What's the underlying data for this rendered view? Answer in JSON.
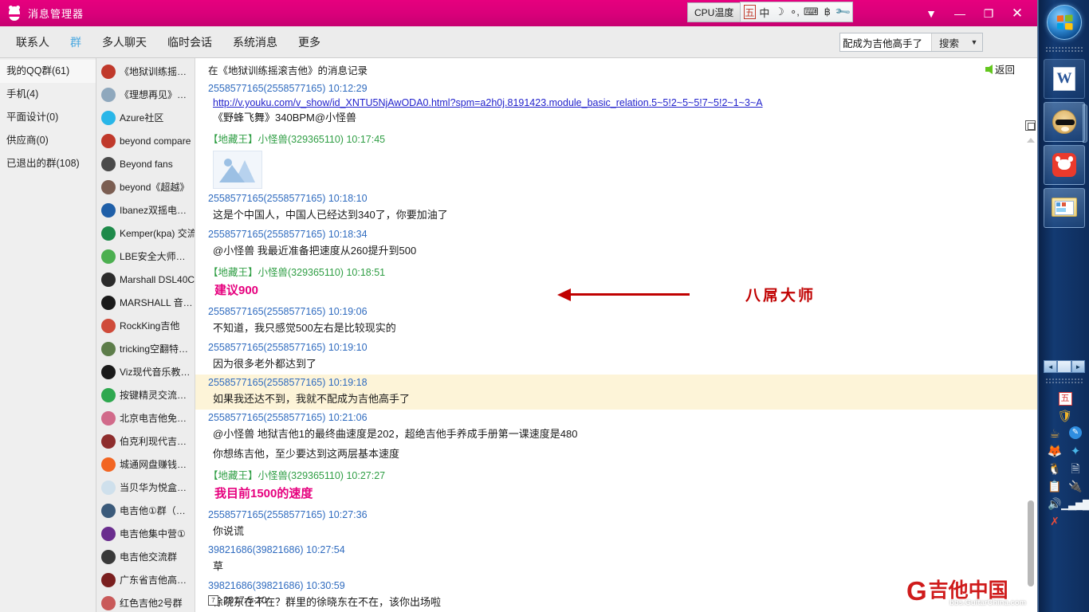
{
  "window": {
    "title": "消息管理器",
    "icon": "qq-penguin-icon",
    "cpu_gadget_label": "CPU温度",
    "controls": {
      "dropdown": "▼",
      "minimize": "—",
      "restore": "❐",
      "close": "✕"
    }
  },
  "ime_bar": {
    "items": [
      {
        "name": "ime-logo",
        "glyph": "五"
      },
      {
        "name": "ime-chinese-mode",
        "glyph": "中"
      },
      {
        "name": "ime-halfwidth",
        "glyph": "☽"
      },
      {
        "name": "ime-punctuation",
        "glyph": "∘,"
      },
      {
        "name": "ime-soft-keyboard",
        "glyph": "⌨"
      },
      {
        "name": "ime-handwriting",
        "glyph": "฿"
      },
      {
        "name": "ime-settings",
        "glyph": "🔧"
      }
    ]
  },
  "tabs": [
    {
      "label": "联系人",
      "active": false
    },
    {
      "label": "群",
      "active": true
    },
    {
      "label": "多人聊天",
      "active": false
    },
    {
      "label": "临时会话",
      "active": false
    },
    {
      "label": "系统消息",
      "active": false
    },
    {
      "label": "更多",
      "active": false
    }
  ],
  "search": {
    "value": "配成为吉他高手了",
    "placeholder": "",
    "button_label": "搜索",
    "caret": "▼"
  },
  "categories": [
    {
      "label": "我的QQ群(61)",
      "active": true
    },
    {
      "label": "手机(4)",
      "active": false
    },
    {
      "label": "平面设计(0)",
      "active": false
    },
    {
      "label": "供应商(0)",
      "active": false
    },
    {
      "label": "已退出的群(108)",
      "active": false
    }
  ],
  "groups": [
    {
      "label": "《地狱训练摇…",
      "color": "#c0392b"
    },
    {
      "label": "《理想再见》…",
      "color": "#8fa8bd"
    },
    {
      "label": "Azure社区",
      "color": "#29b6e8"
    },
    {
      "label": "beyond compare",
      "color": "#c0392b"
    },
    {
      "label": "Beyond fans",
      "color": "#4a4a4a"
    },
    {
      "label": "beyond《超越》",
      "color": "#7b5e52"
    },
    {
      "label": "Ibanez双摇电…",
      "color": "#1f5fa8"
    },
    {
      "label": "Kemper(kpa) 交流",
      "color": "#1e8a4a"
    },
    {
      "label": "LBE安全大师…",
      "color": "#4caf50"
    },
    {
      "label": "Marshall DSL40C",
      "color": "#2b2b2b"
    },
    {
      "label": "MARSHALL 音…",
      "color": "#1a1a1a"
    },
    {
      "label": "RockKing吉他",
      "color": "#cf4b3a"
    },
    {
      "label": "tricking空翻特…",
      "color": "#5d7d4a"
    },
    {
      "label": "Viz现代音乐教…",
      "color": "#1a1a1a"
    },
    {
      "label": "按键精灵交流…",
      "color": "#2ea84f"
    },
    {
      "label": "北京电吉他免…",
      "color": "#d16a8a"
    },
    {
      "label": "伯克利现代吉…",
      "color": "#8e2d2d"
    },
    {
      "label": "城通网盘赚钱…",
      "color": "#f26522"
    },
    {
      "label": "当贝华为悦盒…",
      "color": "#cfe0ec"
    },
    {
      "label": "电吉他①群（…",
      "color": "#3b5a7a"
    },
    {
      "label": "电吉他集中营①",
      "color": "#6a2d8e"
    },
    {
      "label": "电吉他交流群",
      "color": "#3a3a3a"
    },
    {
      "label": "广东省吉他高…",
      "color": "#7a1f1f"
    },
    {
      "label": "红色吉他2号群",
      "color": "#c95a5a"
    }
  ],
  "chat": {
    "header": "在《地狱训练摇滚吉他》的消息记录",
    "return_label": "返回",
    "date_marker": "2017-5-10",
    "messages": [
      {
        "sender": "2558577165(2558577165)",
        "time": "10:12:29",
        "sender_type": "blue",
        "link": "http://v.youku.com/v_show/id_XNTU5NjAwODA0.html?spm=a2h0j.8191423.module_basic_relation.5~5!2~5~5!7~5!2~1~3~A",
        "body": "《野蜂飞舞》340BPM@小怪兽",
        "highlight": false
      },
      {
        "sender": "【地藏王】小怪兽(329365110)",
        "time": "10:17:45",
        "sender_type": "green",
        "image": "broken-image-placeholder",
        "body": "",
        "highlight": false
      },
      {
        "sender": "2558577165(2558577165)",
        "time": "10:18:10",
        "sender_type": "blue",
        "body": "这是个中国人，中国人已经达到340了，你要加油了",
        "highlight": false
      },
      {
        "sender": "2558577165(2558577165)",
        "time": "10:18:34",
        "sender_type": "blue",
        "body": "@小怪兽 我最近准备把速度从260提升到500",
        "highlight": false
      },
      {
        "sender": "【地藏王】小怪兽(329365110)",
        "time": "10:18:51",
        "sender_type": "green",
        "body": "建议900",
        "style": "pinkbig",
        "highlight": false
      },
      {
        "sender": "2558577165(2558577165)",
        "time": "10:19:06",
        "sender_type": "blue",
        "body": "不知道，我只感觉500左右是比较现实的",
        "highlight": false
      },
      {
        "sender": "2558577165(2558577165)",
        "time": "10:19:10",
        "sender_type": "blue",
        "body": "因为很多老外都达到了",
        "highlight": false
      },
      {
        "sender": "2558577165(2558577165)",
        "time": "10:19:18",
        "sender_type": "blue",
        "body": "如果我还达不到，我就不配成为吉他高手了",
        "highlight": true
      },
      {
        "sender": "2558577165(2558577165)",
        "time": "10:21:06",
        "sender_type": "blue",
        "body": "@小怪兽 地狱吉他1的最终曲速度是202，超绝吉他手养成手册第一课速度是480",
        "body2": "你想练吉他，至少要达到这两层基本速度",
        "highlight": false
      },
      {
        "sender": "【地藏王】小怪兽(329365110)",
        "time": "10:27:27",
        "sender_type": "green",
        "body": "我目前1500的速度",
        "style": "pinkbig",
        "highlight": false
      },
      {
        "sender": "2558577165(2558577165)",
        "time": "10:27:36",
        "sender_type": "blue",
        "body": "你说谎",
        "highlight": false
      },
      {
        "sender": "39821686(39821686)",
        "time": "10:27:54",
        "sender_type": "blue",
        "body": "草",
        "highlight": false
      },
      {
        "sender": "39821686(39821686)",
        "time": "10:30:59",
        "sender_type": "blue",
        "body": "徐晓东在不在？群里的徐晓东在不在，该你出场啦",
        "highlight": false
      }
    ]
  },
  "annotation": {
    "text": "八屌大师",
    "color": "#c00000"
  },
  "watermark": {
    "brand_cn": "吉他中国",
    "brand_mark": "G",
    "url": "bbs.GuitarChina.com"
  },
  "taskbar": {
    "start": "start-orb",
    "buttons": [
      {
        "name": "taskbar-word",
        "icon": "word-icon"
      },
      {
        "name": "taskbar-doge-app",
        "icon": "doge-avatar-icon"
      },
      {
        "name": "taskbar-red-app",
        "icon": "red-bull-icon"
      },
      {
        "name": "taskbar-explorer",
        "icon": "folder-icon"
      }
    ],
    "tray_nav": {
      "left": "◄",
      "right": "►"
    },
    "tray": [
      {
        "name": "tray-ime-icon",
        "glyph": "五",
        "cls": "ti-ime",
        "wide": true
      },
      {
        "name": "tray-shield-icon",
        "glyph": "🛡",
        "cls": "ti-shield",
        "wide": true
      },
      {
        "name": "tray-cup-icon",
        "glyph": "☕",
        "cls": "ti-cup",
        "wide": false
      },
      {
        "name": "tray-pen-icon",
        "glyph": "✎",
        "cls": "ti-pen",
        "wide": false
      },
      {
        "name": "tray-fox-icon",
        "glyph": "🦊",
        "cls": "ti-fox",
        "wide": false
      },
      {
        "name": "tray-swirl-icon",
        "glyph": "✦",
        "cls": "ti-swirl",
        "wide": false
      },
      {
        "name": "tray-qq-icon",
        "glyph": "🐧",
        "cls": "ti-qq",
        "wide": false
      },
      {
        "name": "tray-document-icon",
        "glyph": "🗎",
        "cls": "ti-doc",
        "wide": false
      },
      {
        "name": "tray-clipboard-icon",
        "glyph": "📋",
        "cls": "ti-clip",
        "wide": false
      },
      {
        "name": "tray-usb-safe-icon",
        "glyph": "🔌",
        "cls": "ti-usb",
        "wide": false
      },
      {
        "name": "tray-volume-icon",
        "glyph": "🔊",
        "cls": "ti-vol",
        "wide": false
      },
      {
        "name": "tray-network-icon",
        "glyph": "▁▃▅▇",
        "cls": "ti-net",
        "wide": false
      },
      {
        "name": "tray-disconnected-icon",
        "glyph": "✗",
        "cls": "ti-x",
        "wide": false
      }
    ]
  }
}
